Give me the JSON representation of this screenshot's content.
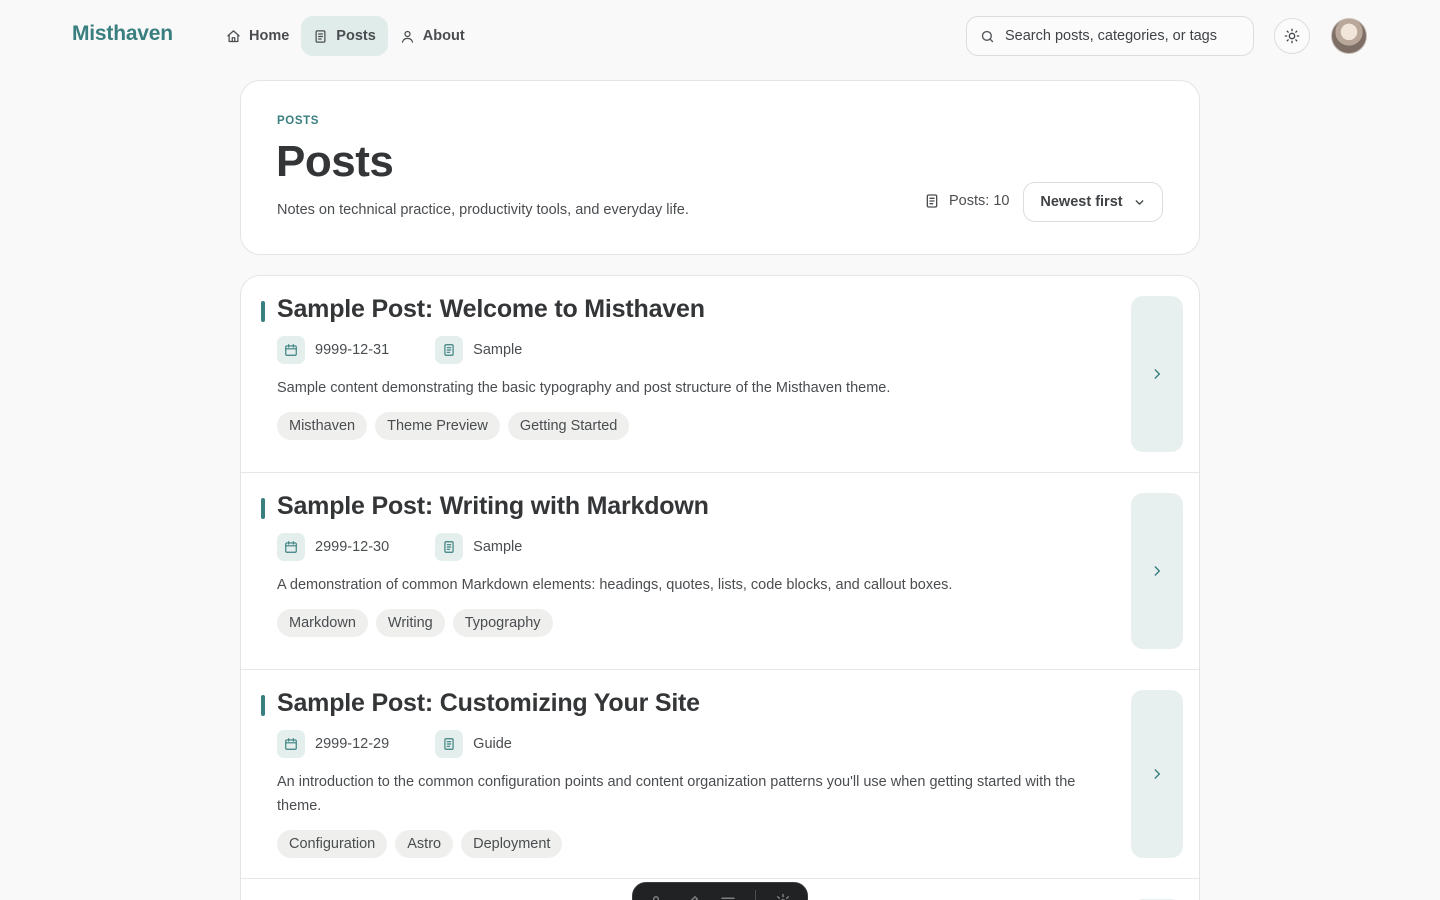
{
  "header": {
    "logo": "Misthaven",
    "nav": [
      {
        "label": "Home",
        "icon": "home-icon"
      },
      {
        "label": "Posts",
        "icon": "document-icon",
        "active": true
      },
      {
        "label": "About",
        "icon": "user-icon"
      }
    ],
    "search_placeholder": "Search posts, categories, or tags",
    "theme_icon": "sun-icon"
  },
  "hero": {
    "eyebrow": "POSTS",
    "title": "Posts",
    "description": "Notes on technical practice, productivity tools, and everyday life.",
    "post_count": "Posts: 10",
    "sort_label": "Newest first"
  },
  "posts": [
    {
      "title": "Sample Post: Welcome to Misthaven",
      "date": "9999-12-31",
      "category": "Sample",
      "excerpt": "Sample content demonstrating the basic typography and post structure of the Misthaven theme.",
      "tags": [
        "Misthaven",
        "Theme Preview",
        "Getting Started"
      ]
    },
    {
      "title": "Sample Post: Writing with Markdown",
      "date": "2999-12-30",
      "category": "Sample",
      "excerpt": "A demonstration of common Markdown elements: headings, quotes, lists, code blocks, and callout boxes.",
      "tags": [
        "Markdown",
        "Writing",
        "Typography"
      ]
    },
    {
      "title": "Sample Post: Customizing Your Site",
      "date": "2999-12-29",
      "category": "Guide",
      "excerpt": "An introduction to the common configuration points and content organization patterns you'll use when getting started with the theme.",
      "tags": [
        "Configuration",
        "Astro",
        "Deployment"
      ]
    }
  ],
  "colors": {
    "accent": "#3a7f80",
    "accent_soft": "#e4efed",
    "background": "#f8f9f8",
    "card": "#ffffff",
    "text": "#333537"
  }
}
